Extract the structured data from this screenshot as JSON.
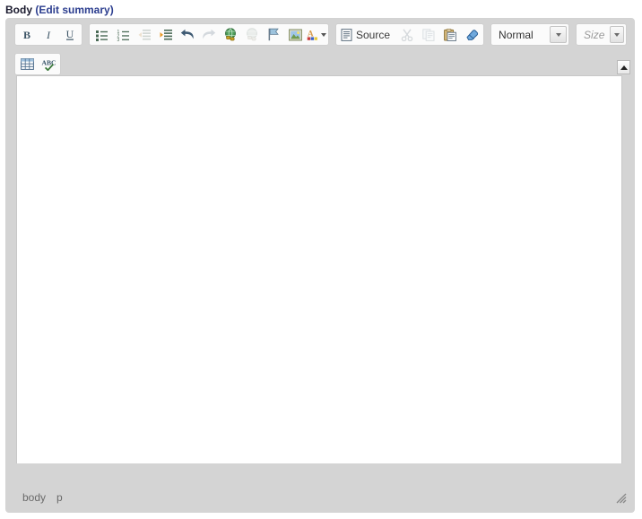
{
  "field": {
    "label": "Body",
    "edit_summary_label": "(Edit summary)"
  },
  "editor": {
    "toolbar_rows": [
      {
        "groups": [
          {
            "name": "basicstyles",
            "buttons": [
              {
                "name": "bold-button",
                "icon": "bold-icon",
                "label": "B",
                "disabled": false
              },
              {
                "name": "italic-button",
                "icon": "italic-icon",
                "label": "I",
                "disabled": false
              },
              {
                "name": "underline-button",
                "icon": "underline-icon",
                "label": "U",
                "disabled": false
              }
            ]
          },
          {
            "name": "paragraph",
            "buttons": [
              {
                "name": "bulleted-list-button",
                "icon": "bulleted-list-icon",
                "label": "Insert/Remove Bulleted List",
                "disabled": false
              },
              {
                "name": "numbered-list-button",
                "icon": "numbered-list-icon",
                "label": "Insert/Remove Numbered List",
                "disabled": false
              },
              {
                "name": "outdent-button",
                "icon": "outdent-icon",
                "label": "Decrease Indent",
                "disabled": true
              },
              {
                "name": "indent-button",
                "icon": "indent-icon",
                "label": "Increase Indent",
                "disabled": false
              },
              {
                "name": "undo-button",
                "icon": "undo-icon",
                "label": "Undo",
                "disabled": false
              },
              {
                "name": "redo-button",
                "icon": "redo-icon",
                "label": "Redo",
                "disabled": true
              },
              {
                "name": "link-button",
                "icon": "link-icon",
                "label": "Link",
                "disabled": false
              },
              {
                "name": "unlink-button",
                "icon": "unlink-icon",
                "label": "Unlink",
                "disabled": true
              },
              {
                "name": "anchor-button",
                "icon": "anchor-flag-icon",
                "label": "Anchor",
                "disabled": false
              },
              {
                "name": "image-button",
                "icon": "image-icon",
                "label": "Image",
                "disabled": false
              },
              {
                "name": "text-color-button",
                "icon": "text-color-icon",
                "label": "Text Color",
                "disabled": false,
                "has_arrow": true
              }
            ]
          },
          {
            "name": "document-clipboard",
            "buttons": [
              {
                "name": "source-button",
                "icon": "source-icon",
                "label": "Source",
                "disabled": false,
                "wide": true
              },
              {
                "name": "cut-button",
                "icon": "scissors-icon",
                "label": "Cut",
                "disabled": true
              },
              {
                "name": "copy-button",
                "icon": "copy-icon",
                "label": "Copy",
                "disabled": true
              },
              {
                "name": "paste-button",
                "icon": "paste-icon",
                "label": "Paste",
                "disabled": false
              },
              {
                "name": "remove-format-button",
                "icon": "eraser-icon",
                "label": "Remove Format",
                "disabled": false
              }
            ]
          }
        ],
        "combos": [
          {
            "name": "format-dropdown",
            "value": "Normal",
            "placeholder": false,
            "width_class": "combo-format"
          },
          {
            "name": "font-size-dropdown",
            "value": "Size",
            "placeholder": true,
            "width_class": "combo-size"
          }
        ]
      },
      {
        "groups": [
          {
            "name": "insert-tools",
            "buttons": [
              {
                "name": "table-button",
                "icon": "table-icon",
                "label": "Table",
                "disabled": false
              },
              {
                "name": "spellcheck-button",
                "icon": "spellcheck-abc-icon",
                "label": "Check Spelling",
                "disabled": false
              }
            ]
          }
        ],
        "combos": []
      }
    ],
    "content": {
      "name": "editing-area",
      "text": ""
    },
    "scrollbar": {
      "up_arrow_name": "scroll-up-arrow"
    },
    "statusbar": {
      "path": [
        "body",
        "p"
      ],
      "resize_name": "resize-grip"
    }
  },
  "colors": {
    "label_text": "#1a1a2e",
    "link": "#2c3e8f",
    "toolbar_bg": "#d4d4d4",
    "group_bg": "#fbfbfb",
    "content_bg": "#ffffff",
    "path_text": "#6a6a6a"
  }
}
